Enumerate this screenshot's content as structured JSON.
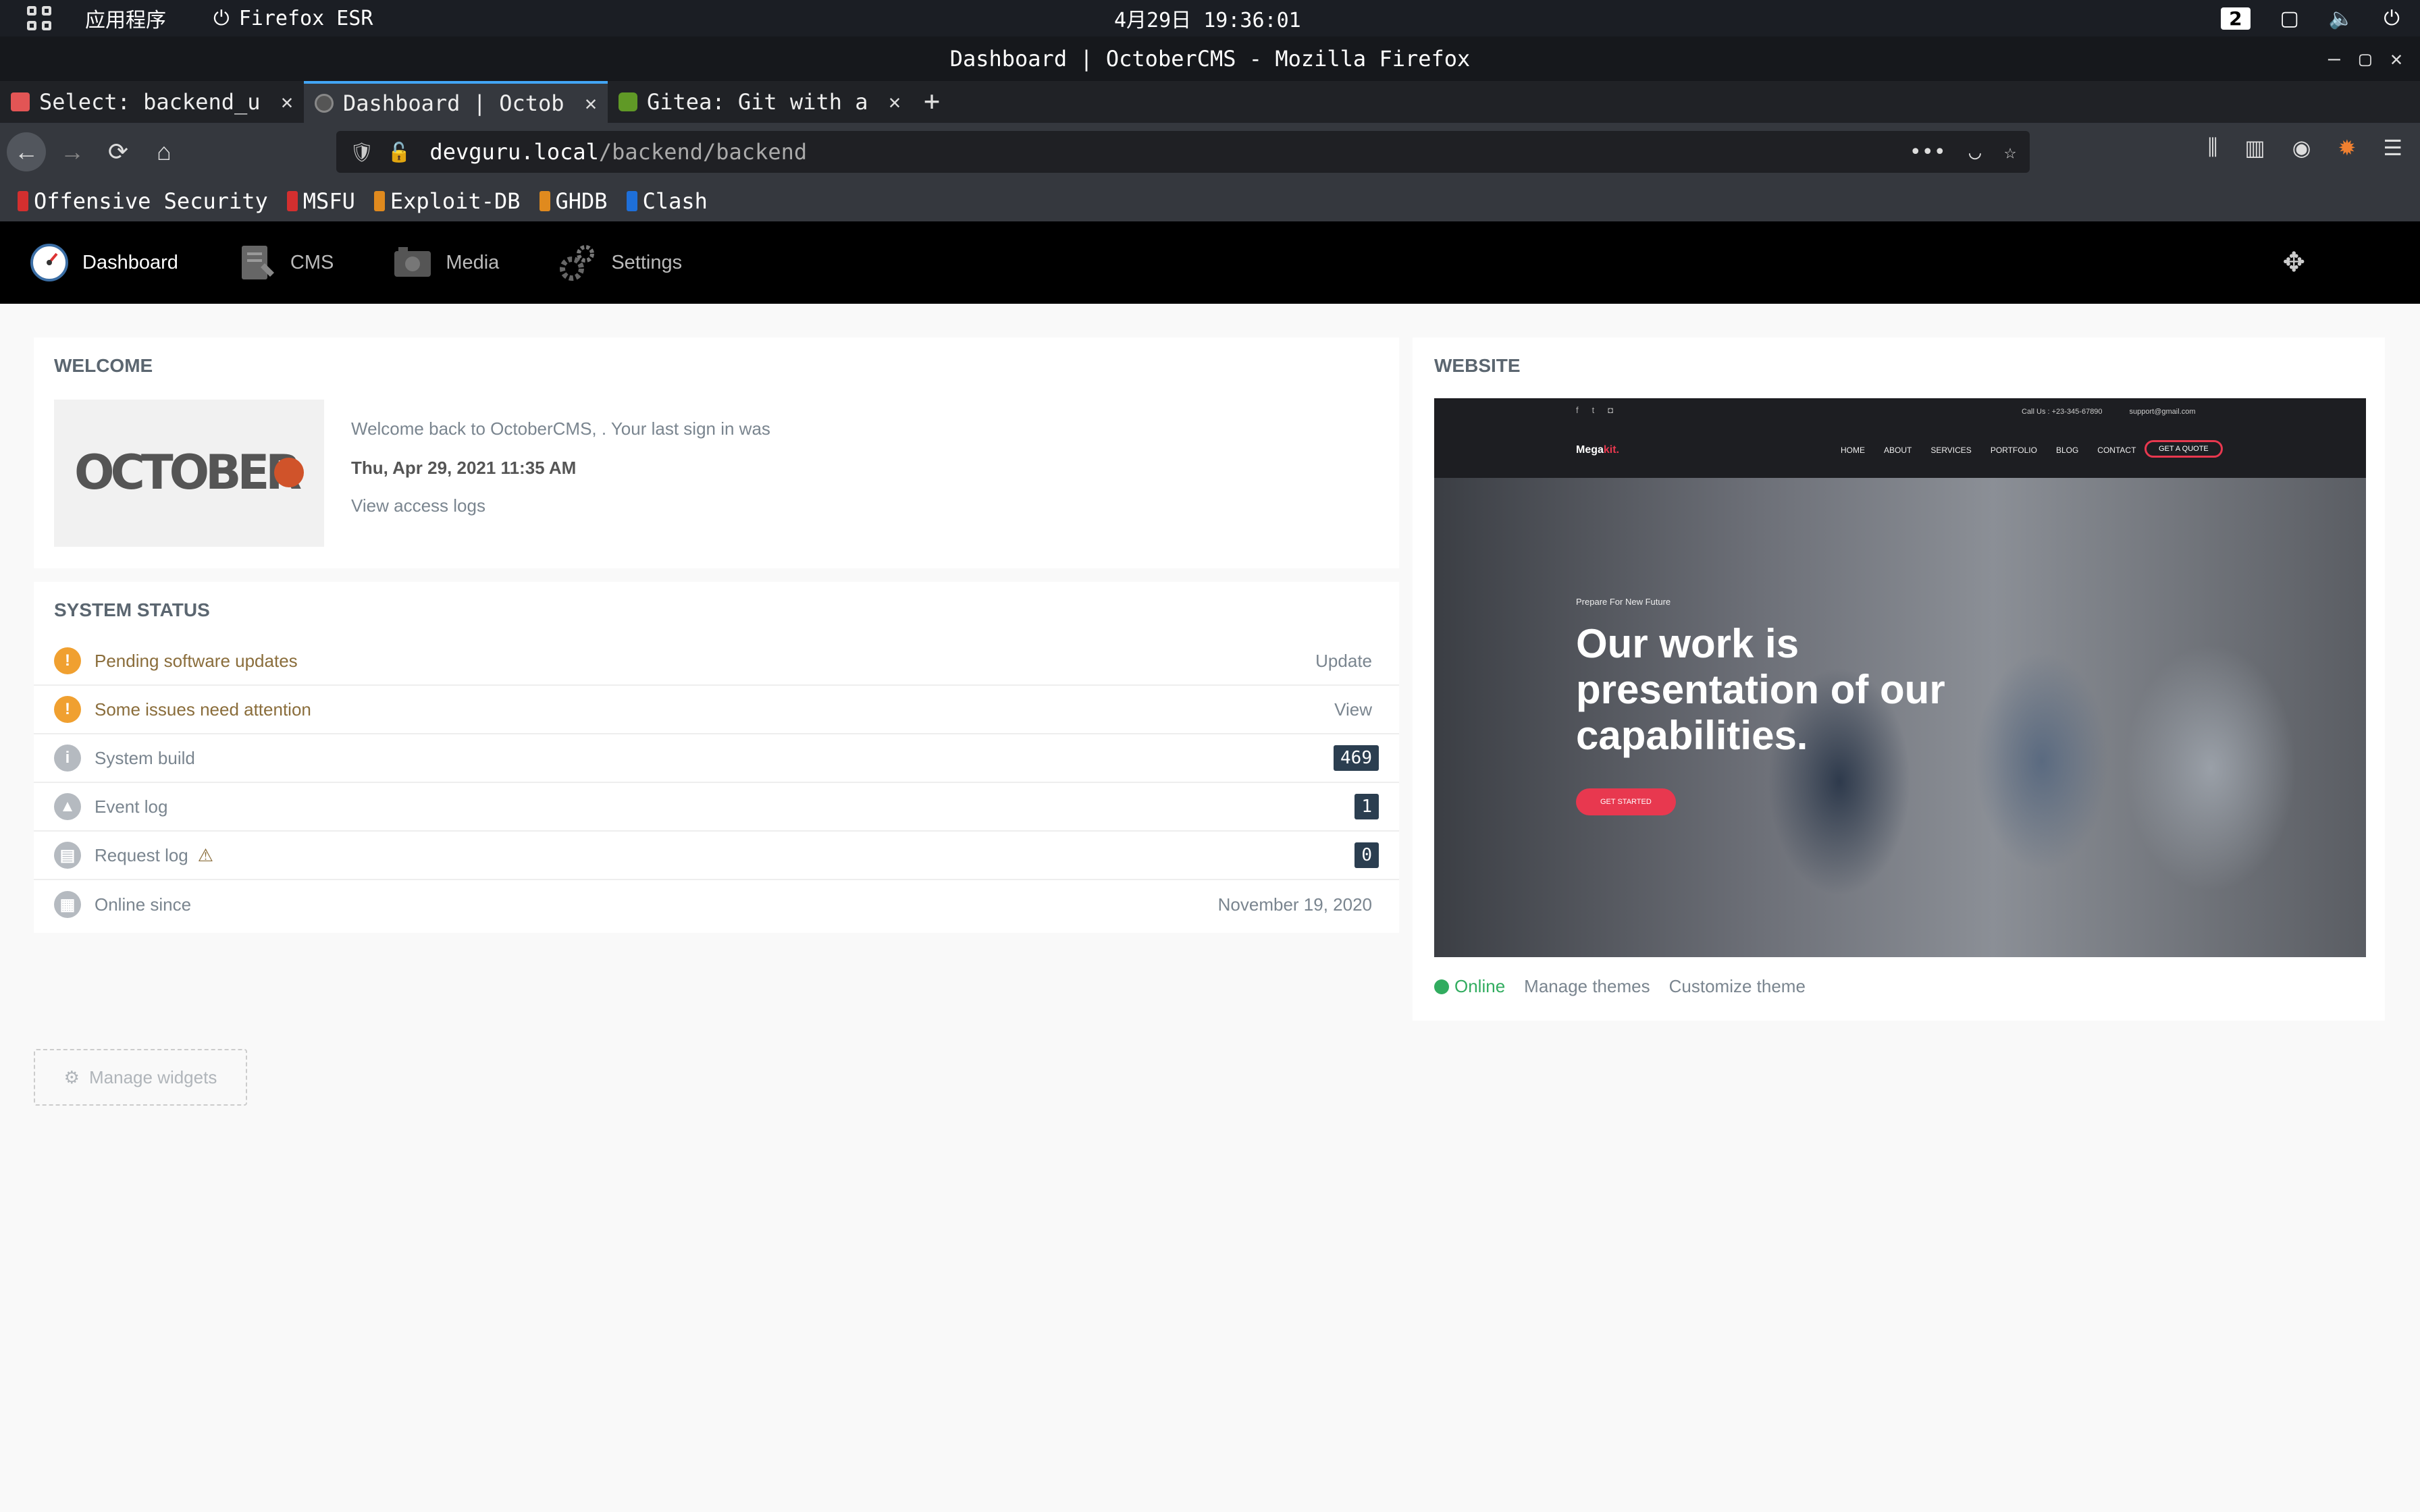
{
  "system_bar": {
    "apps_label": "应用程序",
    "firefox_label": "Firefox ESR",
    "clock": "4月29日 19:36:01",
    "workspace": "2"
  },
  "window": {
    "title": "Dashboard | OctoberCMS - Mozilla Firefox"
  },
  "tabs": [
    {
      "label": "Select: backend_u",
      "active": false
    },
    {
      "label": "Dashboard | Octob",
      "active": true
    },
    {
      "label": "Gitea: Git with a",
      "active": false
    }
  ],
  "url": {
    "host": "devguru.local",
    "path": "/backend/backend"
  },
  "bookmarks": [
    {
      "label": "Offensive Security",
      "color": "#d32f2f"
    },
    {
      "label": "MSFU",
      "color": "#d32f2f"
    },
    {
      "label": "Exploit-DB",
      "color": "#e08a1e"
    },
    {
      "label": "GHDB",
      "color": "#e08a1e"
    },
    {
      "label": "Clash",
      "color": "#1e6fd9"
    }
  ],
  "cms_nav": {
    "items": [
      {
        "label": "Dashboard",
        "icon": "dashboard-icon",
        "active": true
      },
      {
        "label": "CMS",
        "icon": "cms-icon",
        "active": false
      },
      {
        "label": "Media",
        "icon": "media-icon",
        "active": false
      },
      {
        "label": "Settings",
        "icon": "settings-icon",
        "active": false
      }
    ]
  },
  "welcome": {
    "title": "WELCOME",
    "logo_text": "OCTOBER",
    "message": "Welcome back to OctoberCMS, . Your last sign in was",
    "last_signin": "Thu, Apr 29, 2021 11:35 AM",
    "access_logs_link": "View access logs"
  },
  "system_status": {
    "title": "SYSTEM STATUS",
    "rows": [
      {
        "label": "Pending software updates",
        "action": "Update",
        "type": "warn"
      },
      {
        "label": "Some issues need attention",
        "action": "View",
        "type": "warn"
      },
      {
        "label": "System build",
        "badge": "469",
        "type": "info"
      },
      {
        "label": "Event log",
        "badge": "1",
        "type": "info"
      },
      {
        "label": "Request log",
        "badge": "0",
        "type": "info"
      },
      {
        "label": "Online since",
        "value": "November 19, 2020",
        "type": "info"
      }
    ]
  },
  "website": {
    "title": "WEBSITE",
    "preview": {
      "brand": "Mega",
      "brand_suffix": "kit.",
      "call": "Call Us : +23-345-67890",
      "email": "support@gmail.com",
      "nav": [
        "HOME",
        "ABOUT",
        "SERVICES",
        "PORTFOLIO",
        "BLOG",
        "CONTACT"
      ],
      "quote_btn": "GET A QUOTE",
      "tagline": "Prepare For New Future",
      "headline": "Our work is presentation of our capabilities.",
      "cta": "GET STARTED"
    },
    "status": "Online",
    "manage_themes": "Manage themes",
    "customize_theme": "Customize theme"
  },
  "manage_widgets": "Manage widgets"
}
